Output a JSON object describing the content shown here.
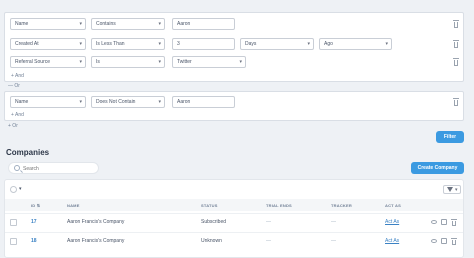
{
  "filters": {
    "group1": {
      "rows": [
        {
          "field": "Name",
          "operator": "Contains",
          "value": "Aaron"
        },
        {
          "field": "Created At",
          "operator": "Is Less Than",
          "value": "3",
          "unit": "Days",
          "direction": "Ago"
        },
        {
          "field": "Referral Source",
          "operator": "Is",
          "value": "Twitter"
        }
      ],
      "add_label": "+ And"
    },
    "or_label": "— Or",
    "group2": {
      "rows": [
        {
          "field": "Name",
          "operator": "Does Not Contain",
          "value": "Aaron"
        }
      ],
      "add_label": "+ And"
    },
    "or_label2": "+ Or",
    "filter_button": "Filter"
  },
  "companies": {
    "title": "Companies",
    "search_placeholder": "Search",
    "create_button": "Create Company",
    "columns": [
      "ID",
      "NAME",
      "STATUS",
      "TRIAL ENDS",
      "TRACKER",
      "ACT AS"
    ],
    "rows": [
      {
        "id": "17",
        "name": "Aaron Francis's Company",
        "status": "Subscribed",
        "trial_ends": "—",
        "tracker": "—",
        "act_as": "Act As"
      },
      {
        "id": "18",
        "name": "Aaron Francis's Company",
        "status": "Unknown",
        "trial_ends": "—",
        "tracker": "—",
        "act_as": "Act As"
      }
    ]
  },
  "icons": [
    "trash-icon",
    "search-icon",
    "funnel-icon",
    "eye-icon",
    "edit-icon",
    "chevron-down-icon"
  ],
  "colors": {
    "accent": "#3b9ae1",
    "link": "#3b82c4",
    "background": "#eef1f5"
  }
}
